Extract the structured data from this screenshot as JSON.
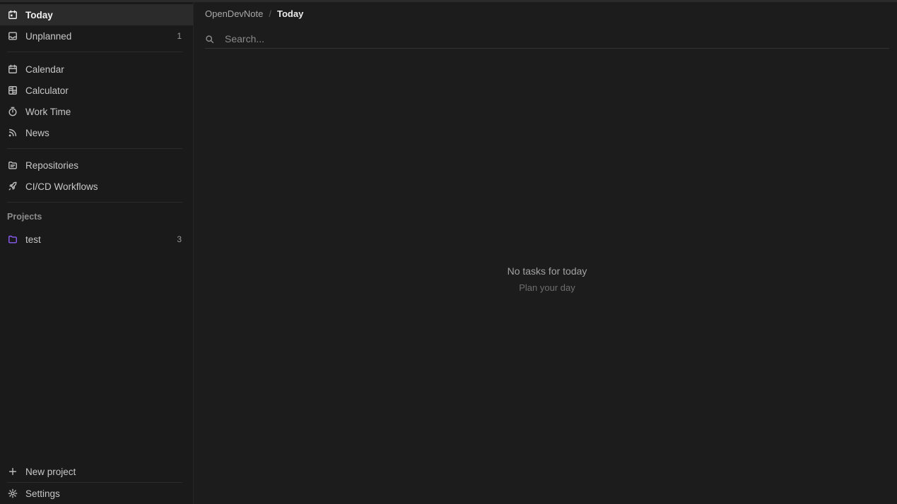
{
  "sidebar": {
    "primary": [
      {
        "label": "Today",
        "icon": "calendar-today-icon",
        "active": true
      },
      {
        "label": "Unplanned",
        "icon": "inbox-icon",
        "count": "1"
      }
    ],
    "tools": [
      {
        "label": "Calendar",
        "icon": "calendar-icon"
      },
      {
        "label": "Calculator",
        "icon": "calculator-icon"
      },
      {
        "label": "Work Time",
        "icon": "stopwatch-icon"
      },
      {
        "label": "News",
        "icon": "rss-icon"
      }
    ],
    "dev": [
      {
        "label": "Repositories",
        "icon": "repository-icon"
      },
      {
        "label": "CI/CD Workflows",
        "icon": "rocket-icon"
      }
    ],
    "projects_title": "Projects",
    "projects": [
      {
        "label": "test",
        "icon": "folder-icon",
        "count": "3",
        "color": "#8b5cf6"
      }
    ],
    "new_project_label": "New project",
    "settings_label": "Settings"
  },
  "breadcrumb": {
    "root": "OpenDevNote",
    "separator": "/",
    "current": "Today"
  },
  "search": {
    "placeholder": "Search..."
  },
  "empty_state": {
    "title": "No tasks for today",
    "subtitle": "Plan your day"
  }
}
